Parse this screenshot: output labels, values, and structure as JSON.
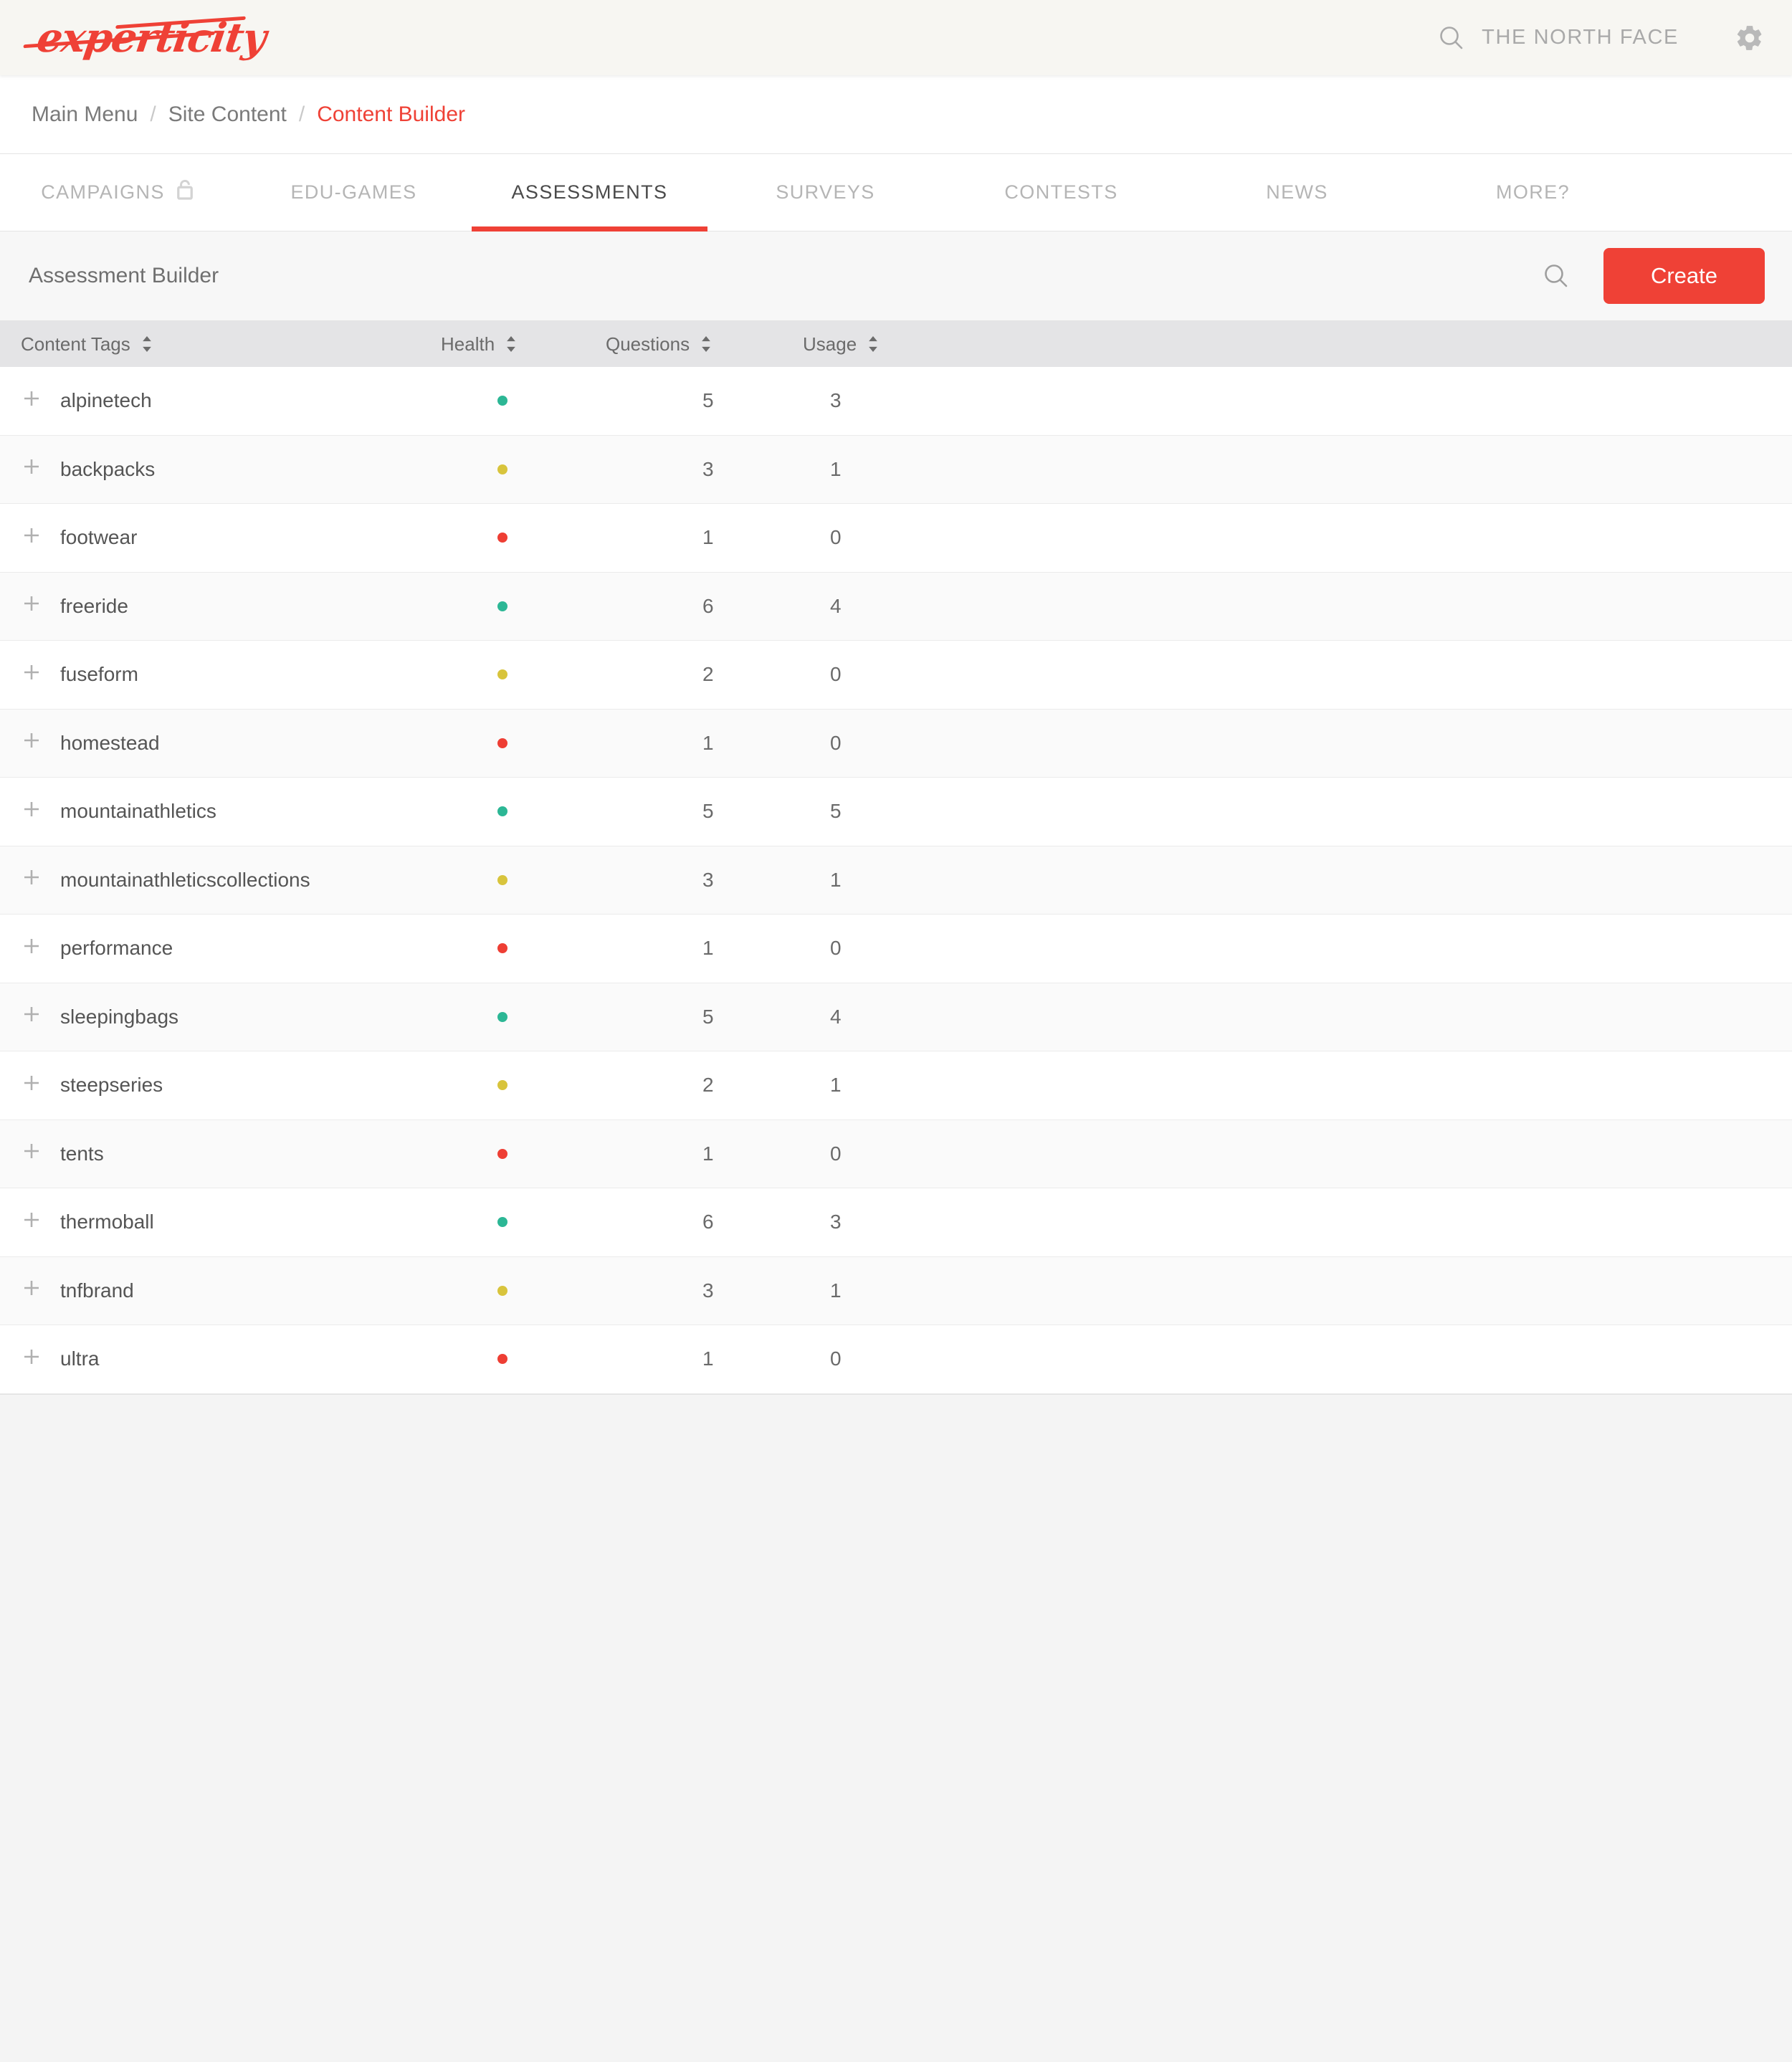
{
  "header": {
    "logo_text": "experticity",
    "brand_label": "THE NORTH FACE",
    "search_icon": "search-icon",
    "settings_icon": "gear-icon"
  },
  "breadcrumb": {
    "items": [
      {
        "label": "Main Menu",
        "active": false
      },
      {
        "label": "Site Content",
        "active": false
      },
      {
        "label": "Content Builder",
        "active": true
      }
    ],
    "separator": "/"
  },
  "tabs": [
    {
      "label": "CAMPAIGNS",
      "active": false,
      "locked": true
    },
    {
      "label": "EDU-GAMES",
      "active": false,
      "locked": false
    },
    {
      "label": "ASSESSMENTS",
      "active": true,
      "locked": false
    },
    {
      "label": "SURVEYS",
      "active": false,
      "locked": false
    },
    {
      "label": "CONTESTS",
      "active": false,
      "locked": false
    },
    {
      "label": "NEWS",
      "active": false,
      "locked": false
    },
    {
      "label": "MORE?",
      "active": false,
      "locked": false
    }
  ],
  "toolbar": {
    "title": "Assessment Builder",
    "search_icon": "search-icon",
    "create_label": "Create"
  },
  "table": {
    "columns": [
      {
        "label": "Content Tags",
        "sortable": true
      },
      {
        "label": "Health",
        "sortable": true
      },
      {
        "label": "Questions",
        "sortable": true
      },
      {
        "label": "Usage",
        "sortable": true
      }
    ],
    "rows": [
      {
        "tag": "alpinetech",
        "health": "green",
        "questions": "5",
        "usage": "3"
      },
      {
        "tag": "backpacks",
        "health": "yellow",
        "questions": "3",
        "usage": "1"
      },
      {
        "tag": "footwear",
        "health": "red",
        "questions": "1",
        "usage": "0"
      },
      {
        "tag": "freeride",
        "health": "green",
        "questions": "6",
        "usage": "4"
      },
      {
        "tag": "fuseform",
        "health": "yellow",
        "questions": "2",
        "usage": "0"
      },
      {
        "tag": "homestead",
        "health": "red",
        "questions": "1",
        "usage": "0"
      },
      {
        "tag": "mountainathletics",
        "health": "green",
        "questions": "5",
        "usage": "5"
      },
      {
        "tag": "mountainathleticscollections",
        "health": "yellow",
        "questions": "3",
        "usage": "1"
      },
      {
        "tag": "performance",
        "health": "red",
        "questions": "1",
        "usage": "0"
      },
      {
        "tag": "sleepingbags",
        "health": "green",
        "questions": "5",
        "usage": "4"
      },
      {
        "tag": "steepseries",
        "health": "yellow",
        "questions": "2",
        "usage": "1"
      },
      {
        "tag": "tents",
        "health": "red",
        "questions": "1",
        "usage": "0"
      },
      {
        "tag": "thermoball",
        "health": "green",
        "questions": "6",
        "usage": "3"
      },
      {
        "tag": "tnfbrand",
        "health": "yellow",
        "questions": "3",
        "usage": "1"
      },
      {
        "tag": "ultra",
        "health": "red",
        "questions": "1",
        "usage": "0"
      }
    ]
  },
  "colors": {
    "accent": "#ef4136",
    "health_green": "#2cb795",
    "health_yellow": "#d8c43c",
    "health_red": "#ee3e34",
    "header_bg": "#f7f6f2",
    "table_header_bg": "#e4e4e6",
    "page_bg": "#f4f4f4"
  }
}
